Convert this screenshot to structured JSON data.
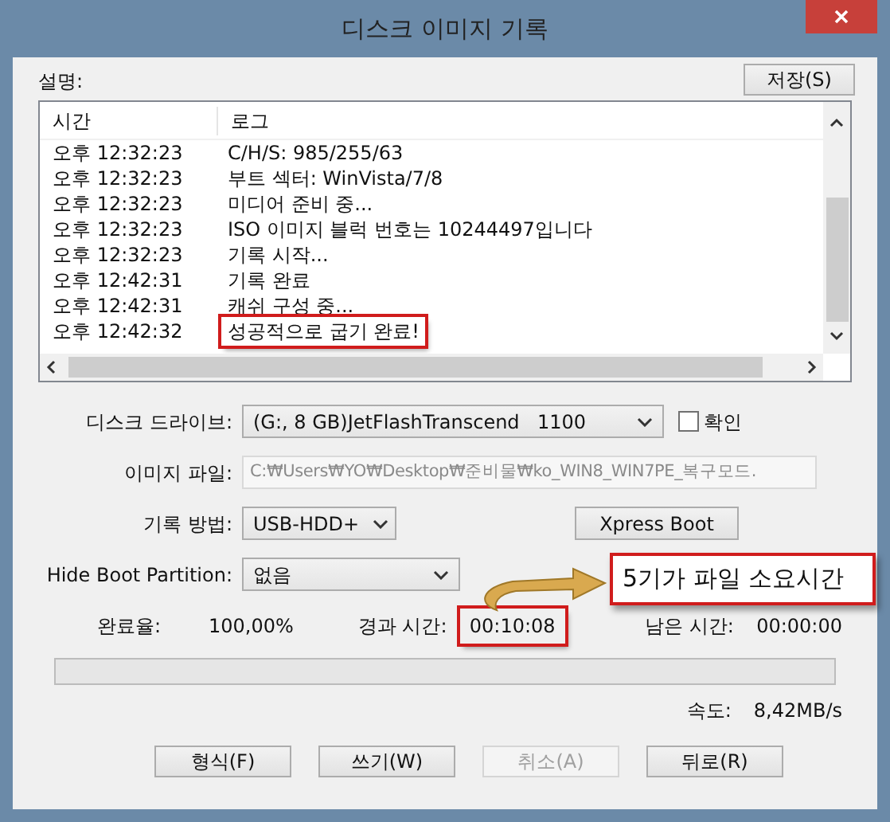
{
  "window": {
    "title": "디스크 이미지 기록"
  },
  "description_label": "설명:",
  "save_button": "저장(S)",
  "log": {
    "columns": [
      "시간",
      "로그"
    ],
    "rows": [
      {
        "time": "오후 12:32:23",
        "message": "C/H/S: 985/255/63",
        "highlighted": false
      },
      {
        "time": "오후 12:32:23",
        "message": "부트 섹터: WinVista/7/8",
        "highlighted": false
      },
      {
        "time": "오후 12:32:23",
        "message": "미디어 준비 중...",
        "highlighted": false
      },
      {
        "time": "오후 12:32:23",
        "message": "ISO 이미지 블럭 번호는 10244497입니다",
        "highlighted": false
      },
      {
        "time": "오후 12:32:23",
        "message": "기록 시작...",
        "highlighted": false
      },
      {
        "time": "오후 12:42:31",
        "message": "기록 완료",
        "highlighted": false
      },
      {
        "time": "오후 12:42:31",
        "message": "캐쉬 구성 중...",
        "highlighted": false
      },
      {
        "time": "오후 12:42:32",
        "message": "성공적으로 굽기 완료!",
        "highlighted": true
      }
    ]
  },
  "drive": {
    "label": "디스크 드라이브:",
    "value": "(G:, 8 GB)JetFlashTranscend",
    "suffix": "1100"
  },
  "verify": {
    "label": "확인",
    "checked": false
  },
  "image_file": {
    "label": "이미지 파일:",
    "value": "C:₩Users₩YO₩Desktop₩준비물₩ko_WIN8_WIN7PE_복구모드.",
    "disabled": true
  },
  "method": {
    "label": "기록 방법:",
    "value": "USB-HDD+"
  },
  "xpress_button": "Xpress Boot",
  "hide_boot": {
    "label": "Hide Boot Partition:",
    "value": "없음"
  },
  "callout": {
    "text": "5기가 파일 소요시간"
  },
  "stats": [
    {
      "label": "완료율:",
      "value": "100,00%",
      "highlighted": false
    },
    {
      "label": "경과 시간:",
      "value": "00:10:08",
      "highlighted": true
    },
    {
      "label": "남은 시간:",
      "value": "00:00:00",
      "highlighted": false
    }
  ],
  "progress": {
    "level": 0
  },
  "speed": {
    "label": "속도:",
    "value": "8,42MB/s"
  },
  "buttons": [
    {
      "label": "형식(F)",
      "disabled": false
    },
    {
      "label": "쓰기(W)",
      "disabled": false
    },
    {
      "label": "취소(A)",
      "disabled": true
    },
    {
      "label": "뒤로(R)",
      "disabled": false
    }
  ]
}
